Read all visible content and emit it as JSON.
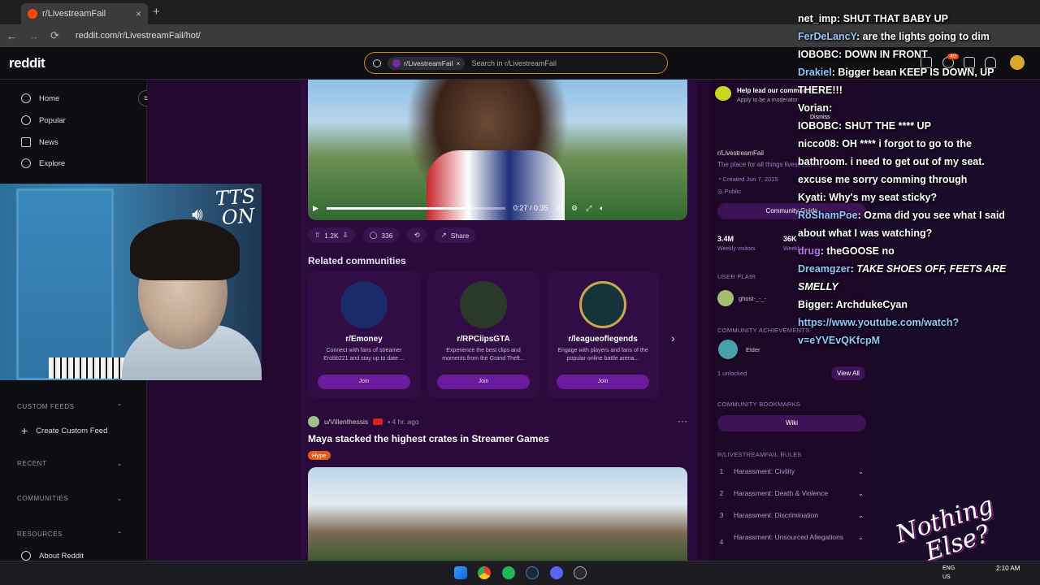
{
  "browser": {
    "tab_title": "r/LivestreamFail",
    "tab_close": "×",
    "new_tab": "+",
    "url": "reddit.com/r/LivestreamFail/hot/",
    "back": "←",
    "forward": "→",
    "reload": "⟳"
  },
  "reddit": {
    "logo": "reddit",
    "search_chip": "r/LivestreamFail",
    "search_chip_close": "×",
    "search_placeholder": "Search in r/LivestreamFail",
    "notif_badge": "40"
  },
  "left_nav": {
    "items": [
      "Home",
      "Popular",
      "News",
      "Explore"
    ],
    "custom_feeds_label": "CUSTOM FEEDS",
    "create_custom_feed": "Create Custom Feed",
    "recent_label": "RECENT",
    "communities_label": "COMMUNITIES",
    "resources_label": "RESOURCES",
    "about_reddit": "About Reddit"
  },
  "video": {
    "time": "0:27 / 0:35",
    "progress": 0.77
  },
  "post_actions": {
    "upvotes": "1.2K",
    "comments": "336",
    "share": "Share"
  },
  "related": {
    "heading": "Related communities",
    "items": [
      {
        "name": "r/Emoney",
        "desc": "Connect with fans of streamer Erobb221 and stay up to date ...",
        "join": "Join",
        "color": "#1b2a6a"
      },
      {
        "name": "r/RPClipsGTA",
        "desc": "Experience the best clips and moments from the Grand Theft...",
        "join": "Join",
        "color": "#2a3a2a"
      },
      {
        "name": "r/leagueoflegends",
        "desc": "Engage with players and fans of the popular online battle arena...",
        "join": "Join",
        "color": "#16323a"
      }
    ]
  },
  "post2": {
    "author": "u/Villenthessis",
    "time": "• 4 hr. ago",
    "title": "Maya stacked the highest crates in Streamer Games",
    "flair": "Hype"
  },
  "sidebar": {
    "help_title": "Help lead our community",
    "help_sub": "Apply to be a moderator",
    "dismiss": "Dismiss",
    "sub_name": "r/LivestreamFail",
    "sub_desc": "The place for all things livestreaming",
    "created": "Created Jun 7, 2015",
    "public": "Public",
    "community_guide": "Community Guide",
    "visitors_value": "3.4M",
    "visitors_label": "Weekly visitors",
    "contrib_value": "36K",
    "contrib_label": "Weekly contributions",
    "user_flair_heading": "USER FLAIR",
    "user_flair_name": "ghost-_-_-",
    "achievements_heading": "COMMUNITY ACHIEVEMENTS",
    "achievement_name": "Elder",
    "unlocked": "1 unlocked",
    "view_all": "View All",
    "bookmarks_heading": "COMMUNITY BOOKMARKS",
    "wiki": "Wiki",
    "rules_heading": "R/LIVESTREAMFAIL RULES",
    "rules": [
      {
        "n": "1",
        "t": "Harassment: Civility"
      },
      {
        "n": "2",
        "t": "Harassment: Death & Violence"
      },
      {
        "n": "3",
        "t": "Harassment: Discrimination"
      },
      {
        "n": "4",
        "t": "Harassment: Unsourced Allegations"
      }
    ]
  },
  "chat": [
    {
      "user": "net_imp",
      "msg": "SHUT THAT BABY UP",
      "color": "#ffffff"
    },
    {
      "user": "FerDeLancY",
      "msg": "are the lights going to dim",
      "color": "#8fc8ff"
    },
    {
      "user": "IOBOBC",
      "msg": "DOWN IN FRONT",
      "color": "#ffffff"
    },
    {
      "user": "Drakiel",
      "msg": "Bigger bean KEEP IS DOWN, UP THERE!!!",
      "color": "#8fc8ff"
    },
    {
      "user": "Vorian",
      "msg": "",
      "color": "#ffffff"
    },
    {
      "user": "IOBOBC",
      "msg": "SHUT THE **** UP",
      "color": "#ffffff"
    },
    {
      "user": "nicco08",
      "msg": "OH **** i forgot to go to the bathroom. i need to get out of my seat. excuse me  sorry  comming through",
      "color": "#ffffff"
    },
    {
      "user": "Kyati",
      "msg": "Why's my seat sticky?",
      "color": "#ffffff"
    },
    {
      "user": "RoShamPoe",
      "msg": "Ozma did you see what I said about what I was watching?",
      "color": "#8fc8ff"
    },
    {
      "user": "drug",
      "msg": "theGOOSE no",
      "color": "#c070ff"
    },
    {
      "user": "Dreamgzer",
      "msg": "TAKE SHOES OFF, FEETS ARE SMELLY",
      "color": "#8fc8ff"
    },
    {
      "user": "Bigger",
      "msg": "ArchdukeCyan",
      "color": "#ffffff"
    },
    {
      "user": "",
      "msg": "https://www.youtube.com/watch?v=eYVEvQKfcpM",
      "color": "#8fc8ff"
    }
  ],
  "webcam": {
    "tts_line1": "TTS",
    "tts_line2": "ON"
  },
  "watermark": {
    "line1": "Nothing",
    "line2": "Else?"
  },
  "taskbar": {
    "lang1": "ENG",
    "lang2": "US",
    "time": "2:10 AM"
  }
}
